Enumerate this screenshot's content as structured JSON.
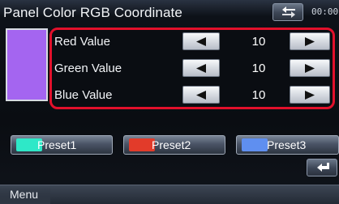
{
  "header": {
    "title": "Panel Color RGB Coordinate",
    "clock": "00:00",
    "back_icon": "back-arrow-icon"
  },
  "preview": {
    "color": "#a465f0"
  },
  "rgb": {
    "highlight_color": "#e2102b",
    "rows": [
      {
        "label": "Red Value",
        "value": "10",
        "dec_icon": "left-triangle-icon",
        "inc_icon": "right-triangle-icon"
      },
      {
        "label": "Green Value",
        "value": "10",
        "dec_icon": "left-triangle-icon",
        "inc_icon": "right-triangle-icon"
      },
      {
        "label": "Blue Value",
        "value": "10",
        "dec_icon": "left-triangle-icon",
        "inc_icon": "right-triangle-icon"
      }
    ]
  },
  "presets": [
    {
      "label": "Preset1",
      "color": "#2ee8c8"
    },
    {
      "label": "Preset2",
      "color": "#e23b2a"
    },
    {
      "label": "Preset3",
      "color": "#5f8ff0"
    }
  ],
  "footer": {
    "menu_label": "Menu",
    "return_icon": "return-icon"
  }
}
